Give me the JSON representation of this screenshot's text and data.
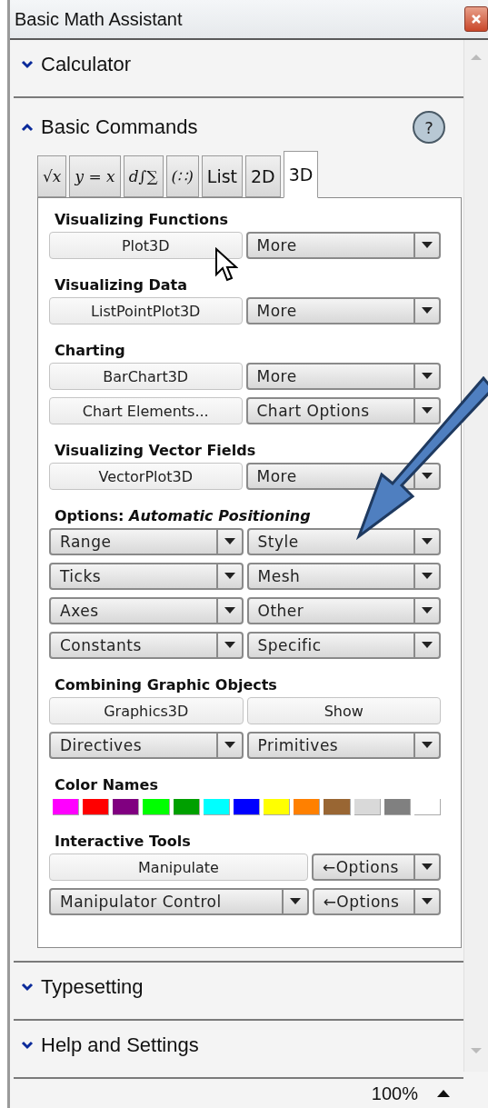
{
  "window": {
    "title": "Basic Math Assistant"
  },
  "sections": [
    {
      "title": "Calculator",
      "expanded": false
    },
    {
      "title": "Basic Commands",
      "expanded": true,
      "help": "?",
      "tabs": [
        {
          "label": "√x",
          "kind": "math",
          "selected": false
        },
        {
          "label": "y = x",
          "kind": "math",
          "selected": false
        },
        {
          "label": "d∫∑",
          "kind": "math",
          "selected": false
        },
        {
          "label": "(∷)",
          "kind": "math",
          "selected": false
        },
        {
          "label": "List",
          "kind": "text",
          "selected": false
        },
        {
          "label": "2D",
          "kind": "text",
          "selected": false
        },
        {
          "label": "3D",
          "kind": "text",
          "selected": true
        }
      ],
      "groups": [
        {
          "title": "Visualizing Functions",
          "rows": [
            [
              {
                "kind": "button",
                "label": "Plot3D"
              },
              {
                "kind": "dropdown",
                "label": "More"
              }
            ]
          ]
        },
        {
          "title": "Visualizing Data",
          "rows": [
            [
              {
                "kind": "button",
                "label": "ListPointPlot3D"
              },
              {
                "kind": "dropdown",
                "label": "More"
              }
            ]
          ]
        },
        {
          "title": "Charting",
          "rows": [
            [
              {
                "kind": "button",
                "label": "BarChart3D"
              },
              {
                "kind": "dropdown",
                "label": "More"
              }
            ],
            [
              {
                "kind": "button",
                "label": "Chart Elements..."
              },
              {
                "kind": "dropdown",
                "label": "Chart Options"
              }
            ]
          ]
        },
        {
          "title": "Visualizing Vector Fields",
          "rows": [
            [
              {
                "kind": "button",
                "label": "VectorPlot3D"
              },
              {
                "kind": "dropdown",
                "label": "More"
              }
            ]
          ]
        },
        {
          "title": "Options: *Automatic Positioning*",
          "rows": [
            [
              {
                "kind": "dropdown",
                "label": "Range"
              },
              {
                "kind": "dropdown",
                "label": "Style"
              }
            ],
            [
              {
                "kind": "dropdown",
                "label": "Ticks"
              },
              {
                "kind": "dropdown",
                "label": "Mesh"
              }
            ],
            [
              {
                "kind": "dropdown",
                "label": "Axes"
              },
              {
                "kind": "dropdown",
                "label": "Other"
              }
            ],
            [
              {
                "kind": "dropdown",
                "label": "Constants"
              },
              {
                "kind": "dropdown",
                "label": "Specific"
              }
            ]
          ]
        },
        {
          "title": "Combining Graphic Objects",
          "rows": [
            [
              {
                "kind": "button",
                "label": "Graphics3D"
              },
              {
                "kind": "button",
                "label": "Show"
              }
            ],
            [
              {
                "kind": "dropdown",
                "label": "Directives"
              },
              {
                "kind": "dropdown",
                "label": "Primitives"
              }
            ]
          ]
        },
        {
          "title": "Color Names",
          "swatches": [
            {
              "color": "#ff00ff"
            },
            {
              "color": "#ff0000"
            },
            {
              "color": "#800080"
            },
            {
              "color": "#00ff00"
            },
            {
              "color": "#00a000"
            },
            {
              "color": "#00ffff"
            },
            {
              "color": "#0000ff"
            },
            {
              "color": "#ffff00"
            },
            {
              "color": "#ff8000"
            },
            {
              "color": "#996633"
            },
            {
              "color": "#d9d9d9"
            },
            {
              "color": "#808080"
            },
            {
              "color": "#ffffff"
            }
          ]
        },
        {
          "title": "Interactive Tools",
          "rows": [
            [
              {
                "kind": "button",
                "label": "Manipulate",
                "wide": true
              },
              {
                "kind": "dropdown",
                "label": "←Options"
              }
            ],
            [
              {
                "kind": "dropdown",
                "label": "Manipulator Control",
                "wide": true
              },
              {
                "kind": "dropdown",
                "label": "←Options"
              }
            ]
          ]
        }
      ]
    },
    {
      "title": "Typesetting",
      "expanded": false
    },
    {
      "title": "Help and Settings",
      "expanded": false
    }
  ],
  "zoom": "100%"
}
